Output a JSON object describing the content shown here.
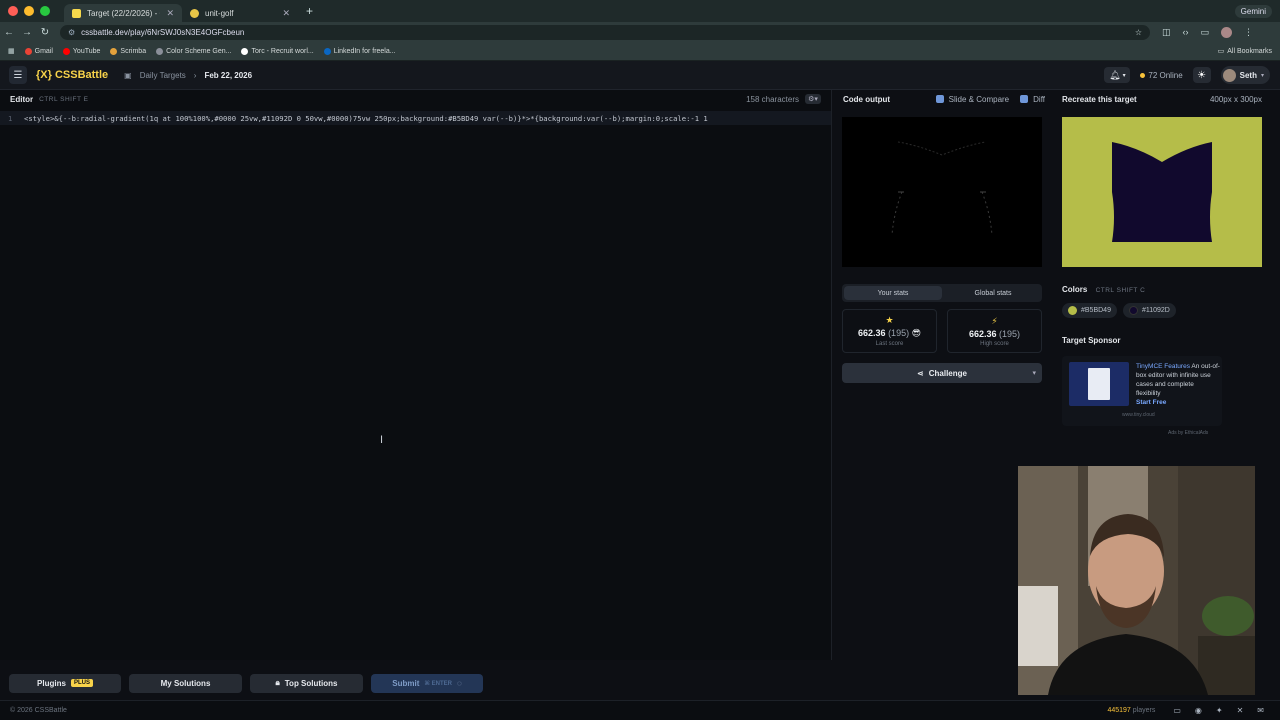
{
  "browser": {
    "tabs": [
      {
        "title": "Target (22/2/2026) - CSSBatt",
        "active": true
      },
      {
        "title": "unit-golf",
        "active": false
      }
    ],
    "new_tab": "+",
    "gemini": "Gemini",
    "url": "cssbattle.dev/play/6NrSWJ0sN3E4OGFcbeun",
    "bookmarks": [
      "Gmail",
      "YouTube",
      "Scrimba",
      "Color Scheme Gen...",
      "Torc - Recruit worl...",
      "LinkedIn for freela..."
    ],
    "all_bookmarks": "All Bookmarks"
  },
  "header": {
    "logo": "{X} CSSBattle",
    "breadcrumb": "Daily Targets",
    "date": "Feb 22, 2026",
    "online": "72 Online",
    "user": "Seth"
  },
  "editor": {
    "title": "Editor",
    "shortcut": "CTRL SHIFT E",
    "chars": "158 characters",
    "line_number": "1",
    "code": "<style>&{--b:radial-gradient(1q at 100%100%,#0000 25vw,#11092D 0 50vw,#0000)75vw 250px;background:#B5BD49 var(--b)}*>*{background:var(--b);margin:0;scale:-1 1"
  },
  "footer_buttons": {
    "plugins": "Plugins",
    "plus": "PLUS",
    "my_solutions": "My Solutions",
    "top_solutions": "Top Solutions",
    "submit": "Submit",
    "submit_key": "⌘ ENTER"
  },
  "output": {
    "title": "Code output",
    "slide_compare": "Slide & Compare",
    "diff": "Diff",
    "tabs": [
      "Your stats",
      "Global stats"
    ],
    "last_score": {
      "value": "662.36",
      "chars": "(195)",
      "label": "Last score"
    },
    "high_score": {
      "value": "662.36",
      "chars": "(195)",
      "label": "High score"
    },
    "challenge": "Challenge"
  },
  "target": {
    "title": "Recreate this target",
    "dimensions": "400px x 300px",
    "colors_label": "Colors",
    "colors_shortcut": "CTRL SHIFT C",
    "colors": [
      {
        "hex": "#B5BD49"
      },
      {
        "hex": "#11092D"
      }
    ],
    "sponsor_label": "Target Sponsor",
    "ad_title": "TinyMCE Features",
    "ad_body": "An out-of-box editor with infinite use cases and complete flexibility",
    "ad_cta": "Start Free",
    "ad_source": "www.tiny.cloud",
    "ad_by": "Ads by EthicalAds"
  },
  "site_footer": {
    "copyright": "© 2026 CSSBattle",
    "players_count": "445197",
    "players_label": "players"
  }
}
